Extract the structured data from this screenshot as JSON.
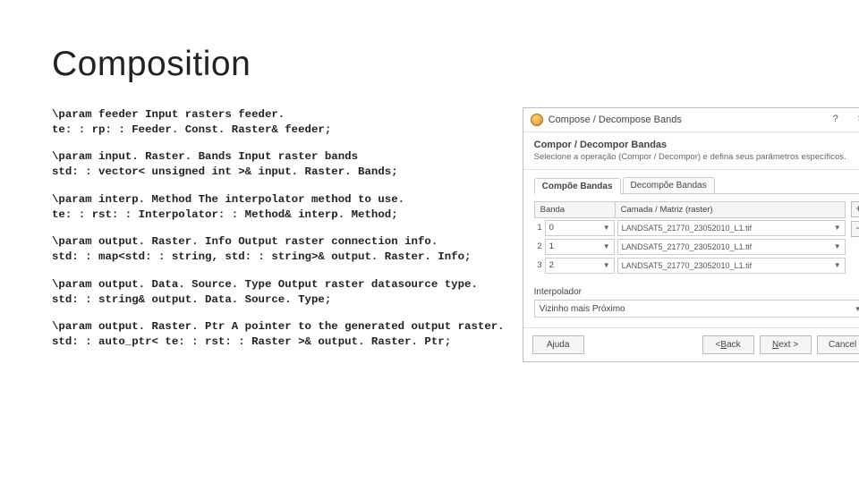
{
  "title": "Composition",
  "doc": {
    "p1l1": "\\param feeder Input rasters feeder.",
    "p1l2": "te: : rp: : Feeder. Const. Raster& feeder;",
    "p2l1": "\\param input. Raster. Bands Input raster bands",
    "p2l2": "std: : vector< unsigned int >& input. Raster. Bands;",
    "p3l1": "\\param interp. Method The interpolator method to use.",
    "p3l2": "te: : rst: : Interpolator: : Method& interp. Method;",
    "p4l1": "\\param output. Raster. Info Output raster connection info.",
    "p4l2": "std: : map<std: : string, std: : string>& output. Raster. Info;",
    "p5l1": "\\param output. Data. Source. Type Output raster datasource type.",
    "p5l2": "std: : string& output. Data. Source. Type;",
    "p6l1": "\\param output. Raster. Ptr A pointer to the generated output raster.",
    "p6l2": "std: : auto_ptr< te: : rst: : Raster >& output. Raster. Ptr;"
  },
  "dialog": {
    "title": "Compose / Decompose Bands",
    "help": "?",
    "close": "×",
    "stripTitle": "Compor / Decompor Bandas",
    "stripSub": "Selecione a operação (Compor / Decompor) e defina seus parâmetros específicos.",
    "tabs": {
      "active": "Compõe Bandas",
      "other": "Decompõe Bandas"
    },
    "headers": {
      "c1": "Banda",
      "c2": "Camada / Matriz (raster)"
    },
    "rows": [
      {
        "idx": "1",
        "band": "0",
        "layer": "LANDSAT5_21770_23052010_L1.tif"
      },
      {
        "idx": "2",
        "band": "1",
        "layer": "LANDSAT5_21770_23052010_L1.tif"
      },
      {
        "idx": "3",
        "band": "2",
        "layer": "LANDSAT5_21770_23052010_L1.tif"
      }
    ],
    "plus": "+",
    "minus": "−",
    "interpLabel": "Interpolador",
    "interpValue": "Vizinho mais Próximo",
    "buttons": {
      "helpPrefix": "A",
      "helpU": "j",
      "helpSuffix": "uda",
      "backPrefix": "< ",
      "backU": "B",
      "backSuffix": "ack",
      "nextPrefix": "",
      "nextU": "N",
      "nextSuffix": "ext >",
      "cancel": "Cancel"
    }
  }
}
